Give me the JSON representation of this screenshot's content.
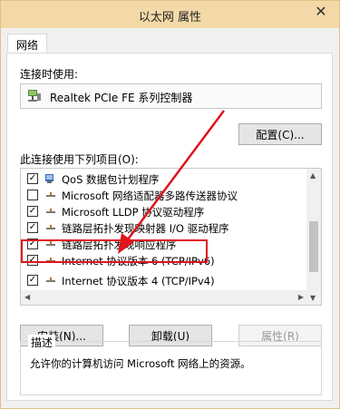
{
  "window": {
    "title": "以太网 属性",
    "close_glyph": "✕"
  },
  "tabs": [
    {
      "label": "网络"
    }
  ],
  "connect_using": {
    "label": "连接时使用:",
    "adapter": "Realtek PCIe FE 系列控制器",
    "configure_button": "配置(C)..."
  },
  "items_label": "此连接使用下列项目(O):",
  "items": [
    {
      "checked": true,
      "icon": "qos-icon",
      "label": "QoS 数据包计划程序"
    },
    {
      "checked": false,
      "icon": "protocol-icon",
      "label": "Microsoft 网络适配器多路传送器协议"
    },
    {
      "checked": true,
      "icon": "protocol-icon",
      "label": "Microsoft LLDP 协议驱动程序"
    },
    {
      "checked": true,
      "icon": "protocol-icon",
      "label": "链路层拓扑发现映射器 I/O 驱动程序"
    },
    {
      "checked": true,
      "icon": "protocol-icon",
      "label": "链路层拓扑发现响应程序"
    },
    {
      "checked": true,
      "icon": "protocol-icon",
      "label": "Internet 协议版本 6 (TCP/IPv6)"
    },
    {
      "checked": true,
      "icon": "protocol-icon",
      "label": "Internet 协议版本 4 (TCP/IPv4)"
    }
  ],
  "buttons": {
    "install": "安装(N)...",
    "uninstall": "卸载(U)",
    "properties": "属性(R)"
  },
  "description": {
    "legend": "描述",
    "text": "允许你的计算机访问 Microsoft 网络上的资源。"
  },
  "colors": {
    "annotation": "#e0141e",
    "titlebar": "#f4d9a8"
  }
}
